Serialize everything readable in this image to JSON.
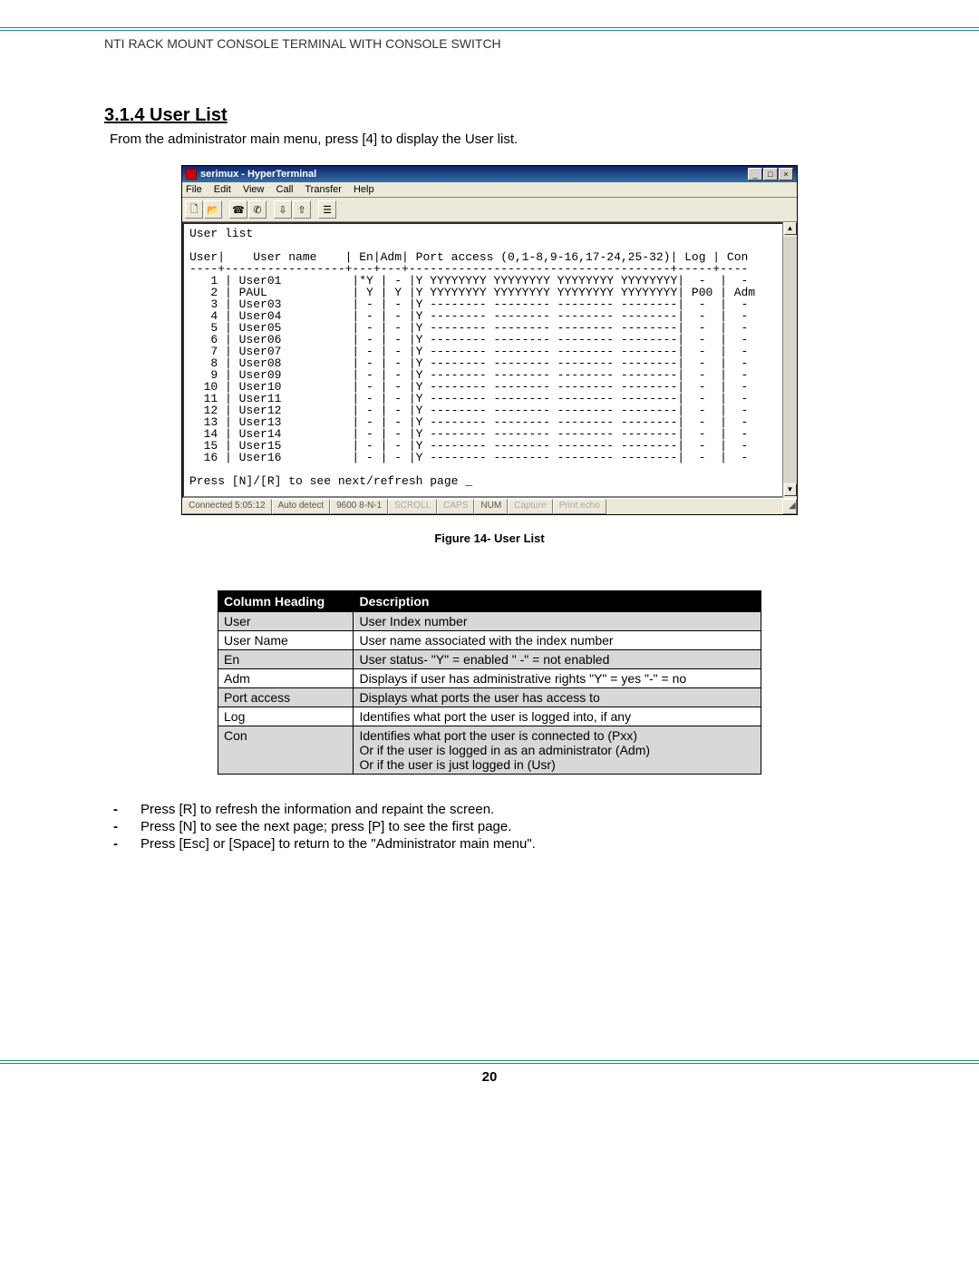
{
  "header": "NTI RACK MOUNT CONSOLE TERMINAL WITH CONSOLE SWITCH",
  "section_number": "3.1.4",
  "section_title": "User List",
  "intro": "From the administrator main menu,  press [4] to display the User list.",
  "hyperterminal": {
    "window_title": "serimux - HyperTerminal",
    "menu": [
      "File",
      "Edit",
      "View",
      "Call",
      "Transfer",
      "Help"
    ],
    "minimize": "_",
    "maximize": "□",
    "close": "×",
    "terminal_lines": [
      "User list",
      "",
      "User|    User name    | En|Adm| Port access (0,1-8,9-16,17-24,25-32)| Log | Con",
      "----+-----------------+---+---+-------------------------------------+-----+----",
      "   1 | User01          |*Y | - |Y YYYYYYYY YYYYYYYY YYYYYYYY YYYYYYYY|  -  |  - ",
      "   2 | PAUL            | Y | Y |Y YYYYYYYY YYYYYYYY YYYYYYYY YYYYYYYY| P00 | Adm",
      "   3 | User03          | - | - |Y -------- -------- -------- --------|  -  |  - ",
      "   4 | User04          | - | - |Y -------- -------- -------- --------|  -  |  - ",
      "   5 | User05          | - | - |Y -------- -------- -------- --------|  -  |  - ",
      "   6 | User06          | - | - |Y -------- -------- -------- --------|  -  |  - ",
      "   7 | User07          | - | - |Y -------- -------- -------- --------|  -  |  - ",
      "   8 | User08          | - | - |Y -------- -------- -------- --------|  -  |  - ",
      "   9 | User09          | - | - |Y -------- -------- -------- --------|  -  |  - ",
      "  10 | User10          | - | - |Y -------- -------- -------- --------|  -  |  - ",
      "  11 | User11          | - | - |Y -------- -------- -------- --------|  -  |  - ",
      "  12 | User12          | - | - |Y -------- -------- -------- --------|  -  |  - ",
      "  13 | User13          | - | - |Y -------- -------- -------- --------|  -  |  - ",
      "  14 | User14          | - | - |Y -------- -------- -------- --------|  -  |  - ",
      "  15 | User15          | - | - |Y -------- -------- -------- --------|  -  |  - ",
      "  16 | User16          | - | - |Y -------- -------- -------- --------|  -  |  - ",
      "",
      "Press [N]/[R] to see next/refresh page _"
    ],
    "status": {
      "connected": "Connected 5:05:12",
      "detect": "Auto detect",
      "settings": "9600 8-N-1",
      "scroll": "SCROLL",
      "caps": "CAPS",
      "num": "NUM",
      "capture": "Capture",
      "echo": "Print echo"
    }
  },
  "figure_caption": "Figure 14- User List",
  "table": {
    "head": [
      "Column Heading",
      "Description"
    ],
    "rows": [
      {
        "shade": true,
        "c1": "User",
        "c2": "User Index number"
      },
      {
        "shade": false,
        "c1": "User Name",
        "c2": "User name associated with the index number"
      },
      {
        "shade": true,
        "c1": "En",
        "c2": "User status- \"Y\" = enabled  \" -\" = not enabled"
      },
      {
        "shade": false,
        "c1": "Adm",
        "c2": "Displays if user has administrative rights   \"Y\" = yes   \"-\" = no"
      },
      {
        "shade": true,
        "c1": "Port access",
        "c2": "Displays what ports the user has access to"
      },
      {
        "shade": false,
        "c1": "Log",
        "c2": "Identifies what port the user is logged into, if any"
      },
      {
        "shade": true,
        "c1": "Con",
        "c2": "Identifies what port the user is connected to (Pxx)\nOr if the user is logged in as an administrator (Adm)\nOr if the user is just logged in (Usr)"
      }
    ]
  },
  "notes": [
    "Press [R] to refresh the information and repaint the screen.",
    "Press [N] to see the next page; press [P] to see the first page.",
    "Press [Esc] or [Space] to return to the \"Administrator main menu\"."
  ],
  "page_number": "20"
}
